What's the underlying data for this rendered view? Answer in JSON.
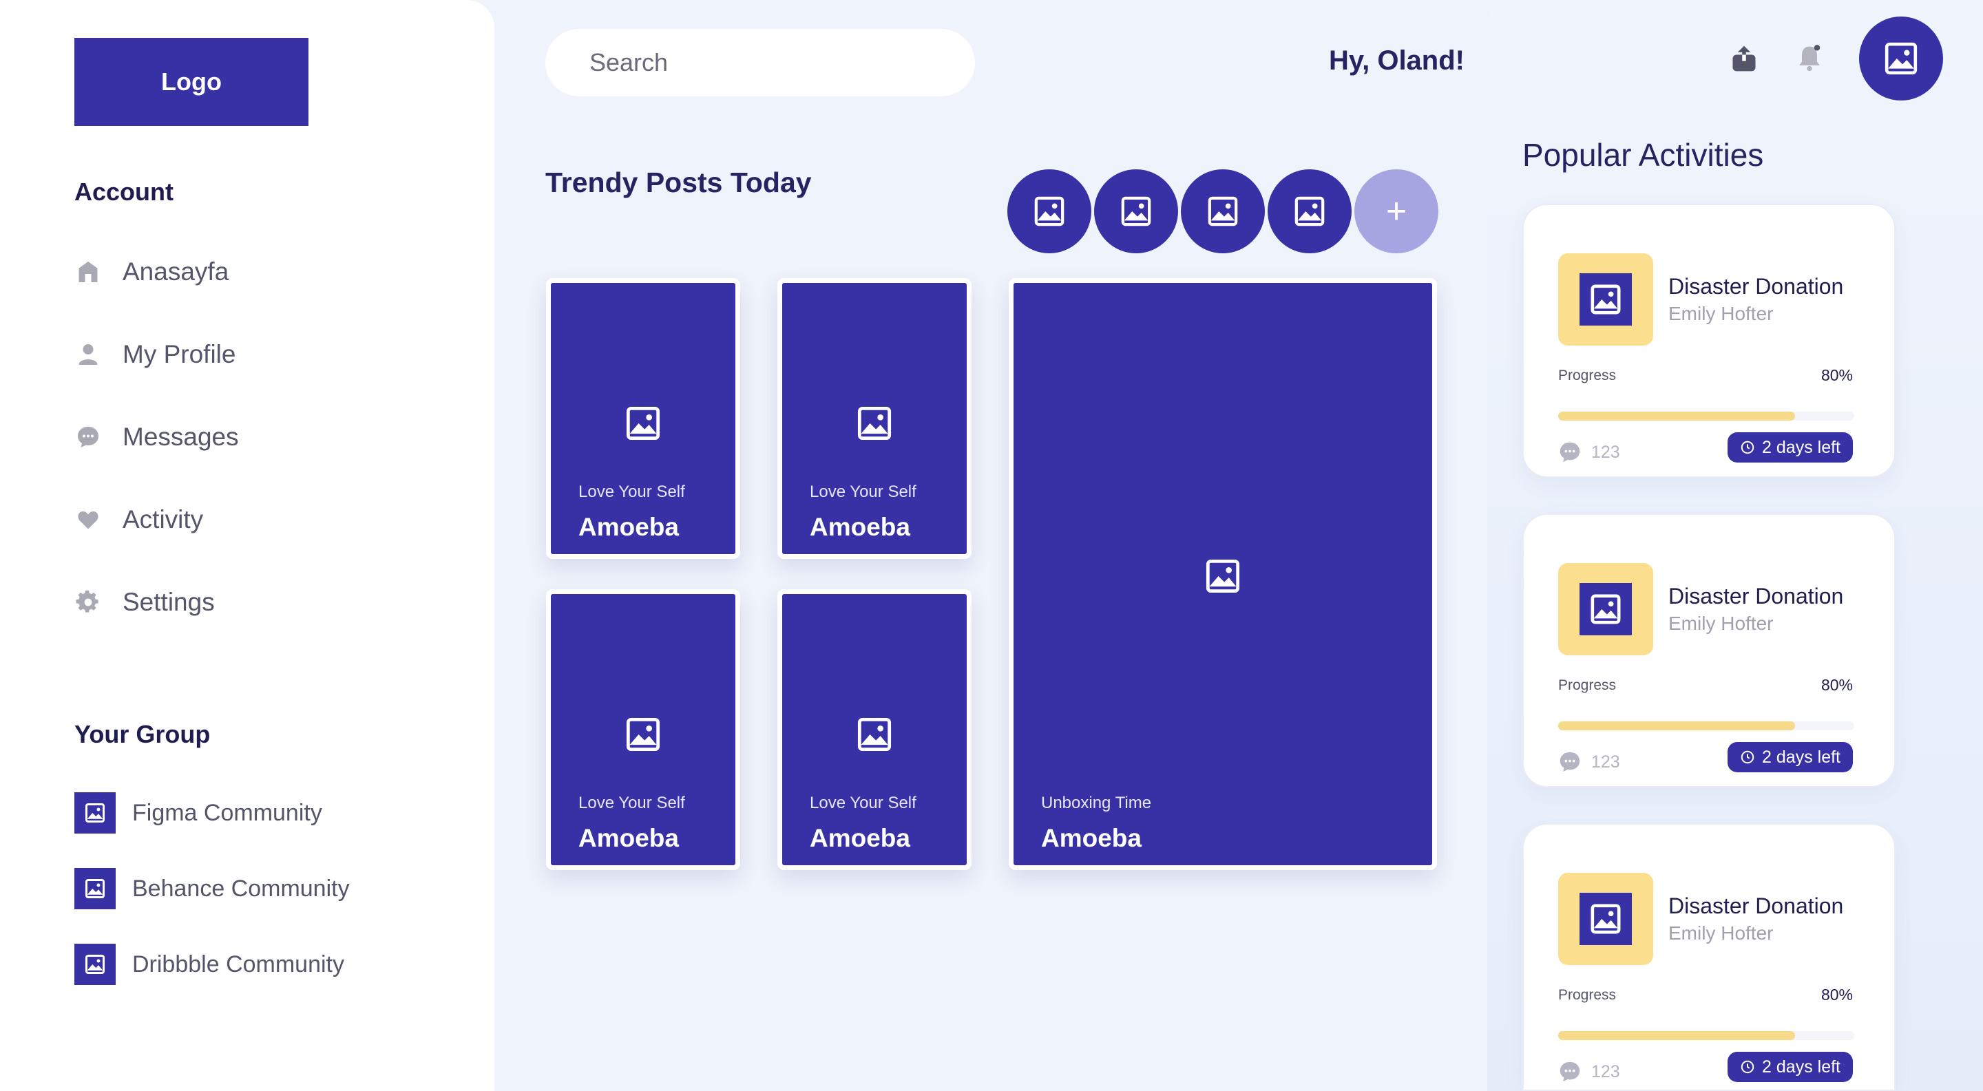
{
  "sidebar": {
    "logo": "Logo",
    "account_heading": "Account",
    "nav": [
      {
        "label": "Anasayfa",
        "icon": "home-icon"
      },
      {
        "label": "My Profile",
        "icon": "user-icon"
      },
      {
        "label": "Messages",
        "icon": "message-icon"
      },
      {
        "label": "Activity",
        "icon": "heart-icon"
      },
      {
        "label": "Settings",
        "icon": "gear-icon"
      }
    ],
    "group_heading": "Your Group",
    "groups": [
      {
        "label": "Figma Community"
      },
      {
        "label": "Behance Community"
      },
      {
        "label": "Dribbble Community"
      }
    ]
  },
  "header": {
    "search_placeholder": "Search",
    "greeting": "Hy, Oland!"
  },
  "trendy": {
    "title": "Trendy Posts Today",
    "add_label": "+",
    "posts": [
      {
        "subtitle": "Love Your Self",
        "title": "Amoeba"
      },
      {
        "subtitle": "Love Your Self",
        "title": "Amoeba"
      },
      {
        "subtitle": "Unboxing Time",
        "title": "Amoeba"
      },
      {
        "subtitle": "Love Your Self",
        "title": "Amoeba"
      },
      {
        "subtitle": "Love Your Self",
        "title": "Amoeba"
      }
    ]
  },
  "popular": {
    "title": "Popular Activities",
    "items": [
      {
        "title": "Disaster Donation",
        "author": "Emily Hofter",
        "progress_label": "Progress",
        "progress_value": "80%",
        "progress": 0.8,
        "comments": "123",
        "deadline": "2 days left"
      },
      {
        "title": "Disaster Donation",
        "author": "Emily Hofter",
        "progress_label": "Progress",
        "progress_value": "80%",
        "progress": 0.8,
        "comments": "123",
        "deadline": "2 days left"
      },
      {
        "title": "Disaster Donation",
        "author": "Emily Hofter",
        "progress_label": "Progress",
        "progress_value": "80%",
        "progress": 0.8,
        "comments": "123",
        "deadline": "2 days left"
      }
    ]
  },
  "colors": {
    "brand": "#3731a5",
    "accent_yellow": "#fbdf8e",
    "background": "#eff3fb"
  }
}
